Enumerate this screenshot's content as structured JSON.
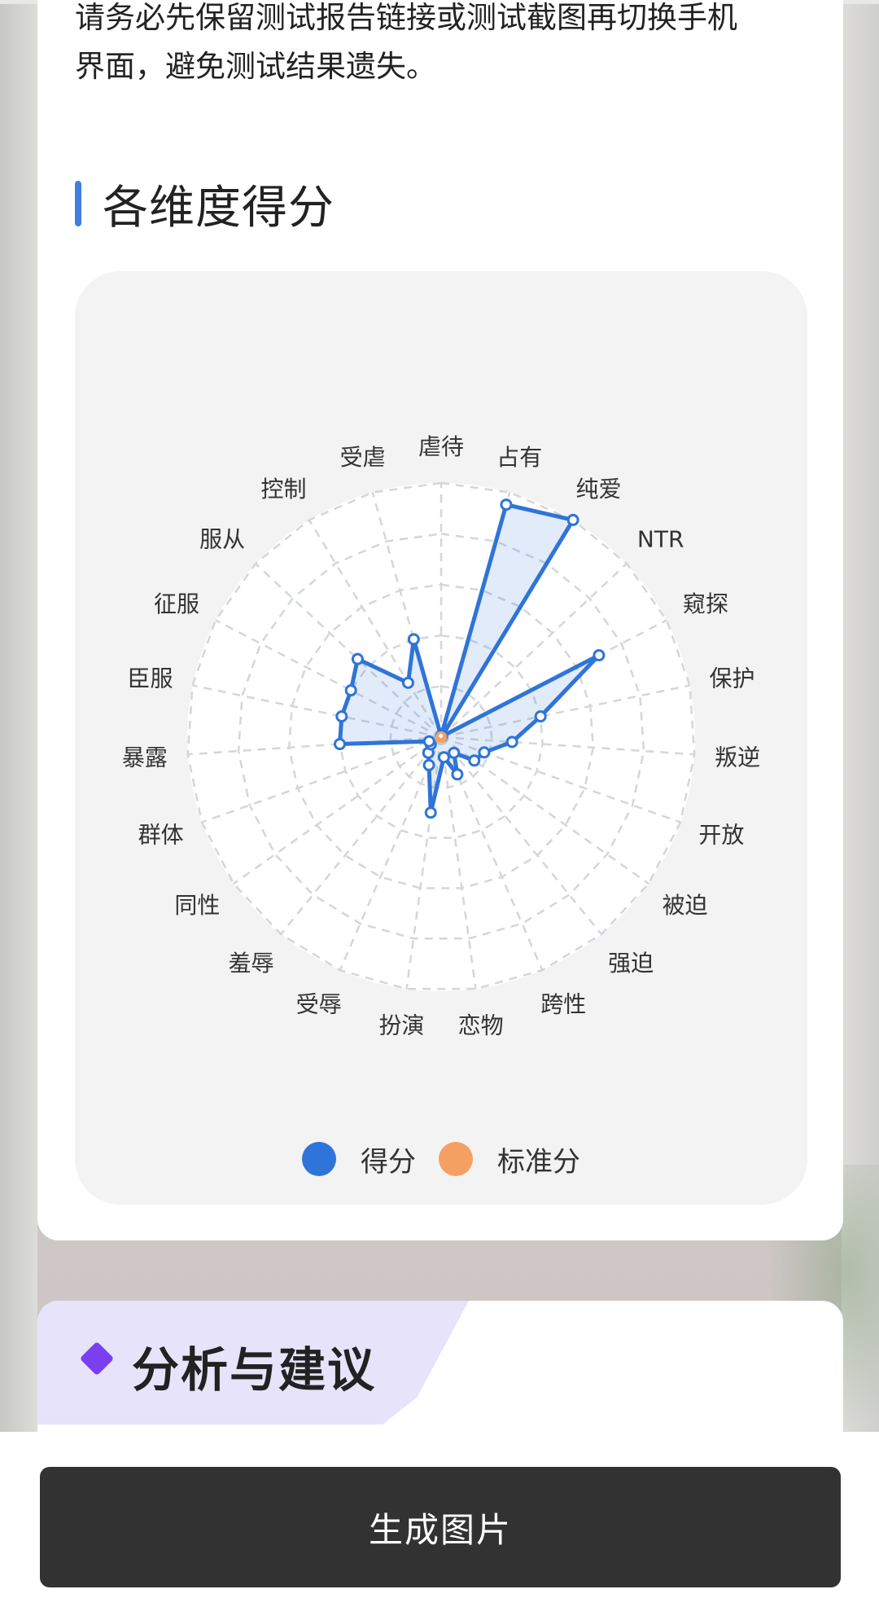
{
  "notice": {
    "line1": "请务必先保留测试报告链接或测试截图再切换手机",
    "line2": "界面，避免测试结果遗失。"
  },
  "section": {
    "title": "各维度得分"
  },
  "chart_data": {
    "type": "radar",
    "categories": [
      "虐待",
      "占有",
      "纯爱",
      "NTR",
      "窥探",
      "保护",
      "叛逆",
      "开放",
      "被迫",
      "强迫",
      "跨性",
      "恋物",
      "扮演",
      "受辱",
      "羞辱",
      "同性",
      "群体",
      "暴露",
      "臣服",
      "征服",
      "服从",
      "控制",
      "受虐"
    ],
    "series": [
      {
        "name": "得分",
        "values": [
          0.4,
          95,
          100,
          0.4,
          70,
          40,
          28,
          18,
          16,
          8,
          16,
          8,
          30,
          12,
          8,
          5,
          5,
          40,
          40,
          40,
          45,
          25,
          40
        ],
        "color": "#2f74d8"
      },
      {
        "name": "标准分",
        "values": [
          0.5,
          0.5,
          0.5,
          0.5,
          0.5,
          0.5,
          0.5,
          0.5,
          0.5,
          0.5,
          0.5,
          0.5,
          0.5,
          0.5,
          0.5,
          0.5,
          0.5,
          0.5,
          0.5,
          0.5,
          0.5,
          0.5,
          0.5
        ],
        "color": "#f5a063"
      }
    ],
    "rlim": [
      0,
      100
    ],
    "rings": 5,
    "grid": true,
    "legend": "bottom"
  },
  "legend": {
    "score_label": "得分",
    "standard_label": "标准分",
    "score_color": "#2f74d8",
    "standard_color": "#f5a063"
  },
  "analysis": {
    "title": "分析与建议",
    "icon": "diamond-icon",
    "accent": "#7b3ff2"
  },
  "button": {
    "label": "生成图片"
  }
}
